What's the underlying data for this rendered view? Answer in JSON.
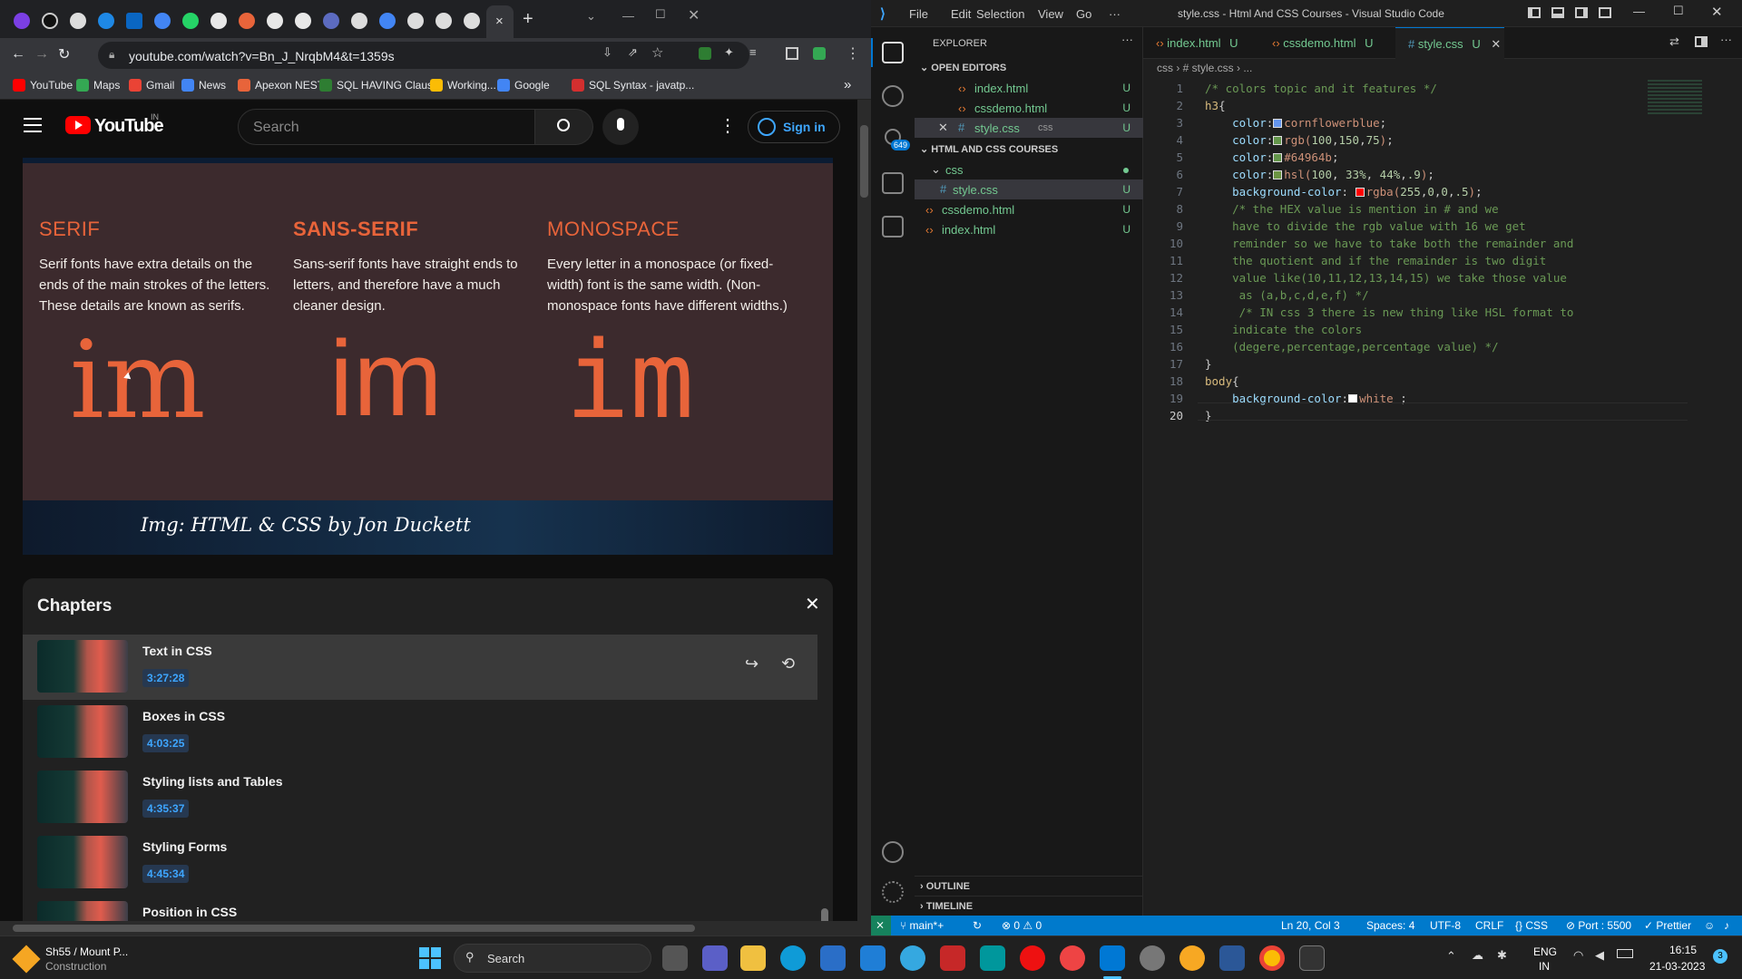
{
  "chrome": {
    "url": "youtube.com/watch?v=Bn_J_NrqbM4&t=1359s",
    "tab_close": "×",
    "new_tab": "+",
    "bookmarks": [
      "YouTube",
      "Maps",
      "Gmail",
      "News",
      "Apexon NEST",
      "SQL HAVING Clause",
      "Working...",
      "Google",
      "SQL Syntax - javatp..."
    ],
    "bookmark_colors": [
      "#ff0000",
      "#34a853",
      "#ea4335",
      "#4285f4",
      "#e8643a",
      "#2e7d32",
      "#fbbc05",
      "#4285f4",
      "#d32f2f"
    ],
    "more": "»"
  },
  "youtube": {
    "logo_text": "YouTube",
    "logo_badge": "IN",
    "search_placeholder": "Search",
    "sign_in": "Sign in",
    "slide": {
      "serif_heading": "SERIF",
      "serif_text": "Serif fonts have extra details on the ends of the main strokes of the letters. These details are known as serifs.",
      "sans_heading": "SANS-SERIF",
      "sans_text": "Sans-serif fonts have straight ends to letters, and therefore have a much cleaner design.",
      "mono_heading": "MONOSPACE",
      "mono_text": "Every letter in a monospace (or fixed-width) font is the same width. (Non-monospace fonts have different widths.)",
      "sample": "im",
      "caption": "Img: HTML & CSS by Jon Duckett"
    },
    "chapters_title": "Chapters",
    "chapters": [
      {
        "title": "Text in CSS",
        "time": "3:27:28"
      },
      {
        "title": "Boxes in CSS",
        "time": "4:03:25"
      },
      {
        "title": "Styling lists and Tables",
        "time": "4:35:37"
      },
      {
        "title": "Styling Forms",
        "time": "4:45:34"
      },
      {
        "title": "Position in CSS",
        "time": ""
      }
    ]
  },
  "vscode": {
    "menu": [
      "File",
      "Edit",
      "Selection",
      "View",
      "Go",
      "···"
    ],
    "title": "style.css - Html And CSS Courses - Visual Studio Code",
    "explorer_title": "EXPLORER",
    "open_editors": "OPEN EDITORS",
    "open_files": [
      {
        "name": "index.html",
        "status": "U"
      },
      {
        "name": "cssdemo.html",
        "status": "U"
      },
      {
        "name": "style.css",
        "extra": "css",
        "status": "U"
      }
    ],
    "project": "HTML AND CSS COURSES",
    "folder": "css",
    "tree": [
      {
        "name": "style.css",
        "status": "U"
      },
      {
        "name": "cssdemo.html",
        "status": "U"
      },
      {
        "name": "index.html",
        "status": "U"
      }
    ],
    "outline": "OUTLINE",
    "timeline": "TIMELINE",
    "scm_badge": "649",
    "tabs": [
      {
        "name": "index.html",
        "status": "U"
      },
      {
        "name": "cssdemo.html",
        "status": "U"
      },
      {
        "name": "style.css",
        "status": "U"
      }
    ],
    "breadcrumb": "css  ›  # style.css  ›  ...",
    "status": {
      "branch": "main*+",
      "errors": "⊗ 0 ⚠ 0",
      "position": "Ln 20, Col 3",
      "spaces": "Spaces: 4",
      "encoding": "UTF-8",
      "eol": "CRLF",
      "lang": "{} CSS",
      "port": "⊘ Port : 5500",
      "prettier": "✓ Prettier"
    },
    "swatches": [
      "#6495ed",
      "#64964b",
      "#64964b",
      "#6b9442",
      "#ff0000",
      "#ffffff"
    ]
  },
  "taskbar": {
    "weather_title": "Sh55 / Mount P...",
    "weather_sub": "Construction",
    "search": "Search",
    "lang": "ENG",
    "region": "IN",
    "time": "16:15",
    "date": "21-03-2023",
    "notif": "3"
  }
}
